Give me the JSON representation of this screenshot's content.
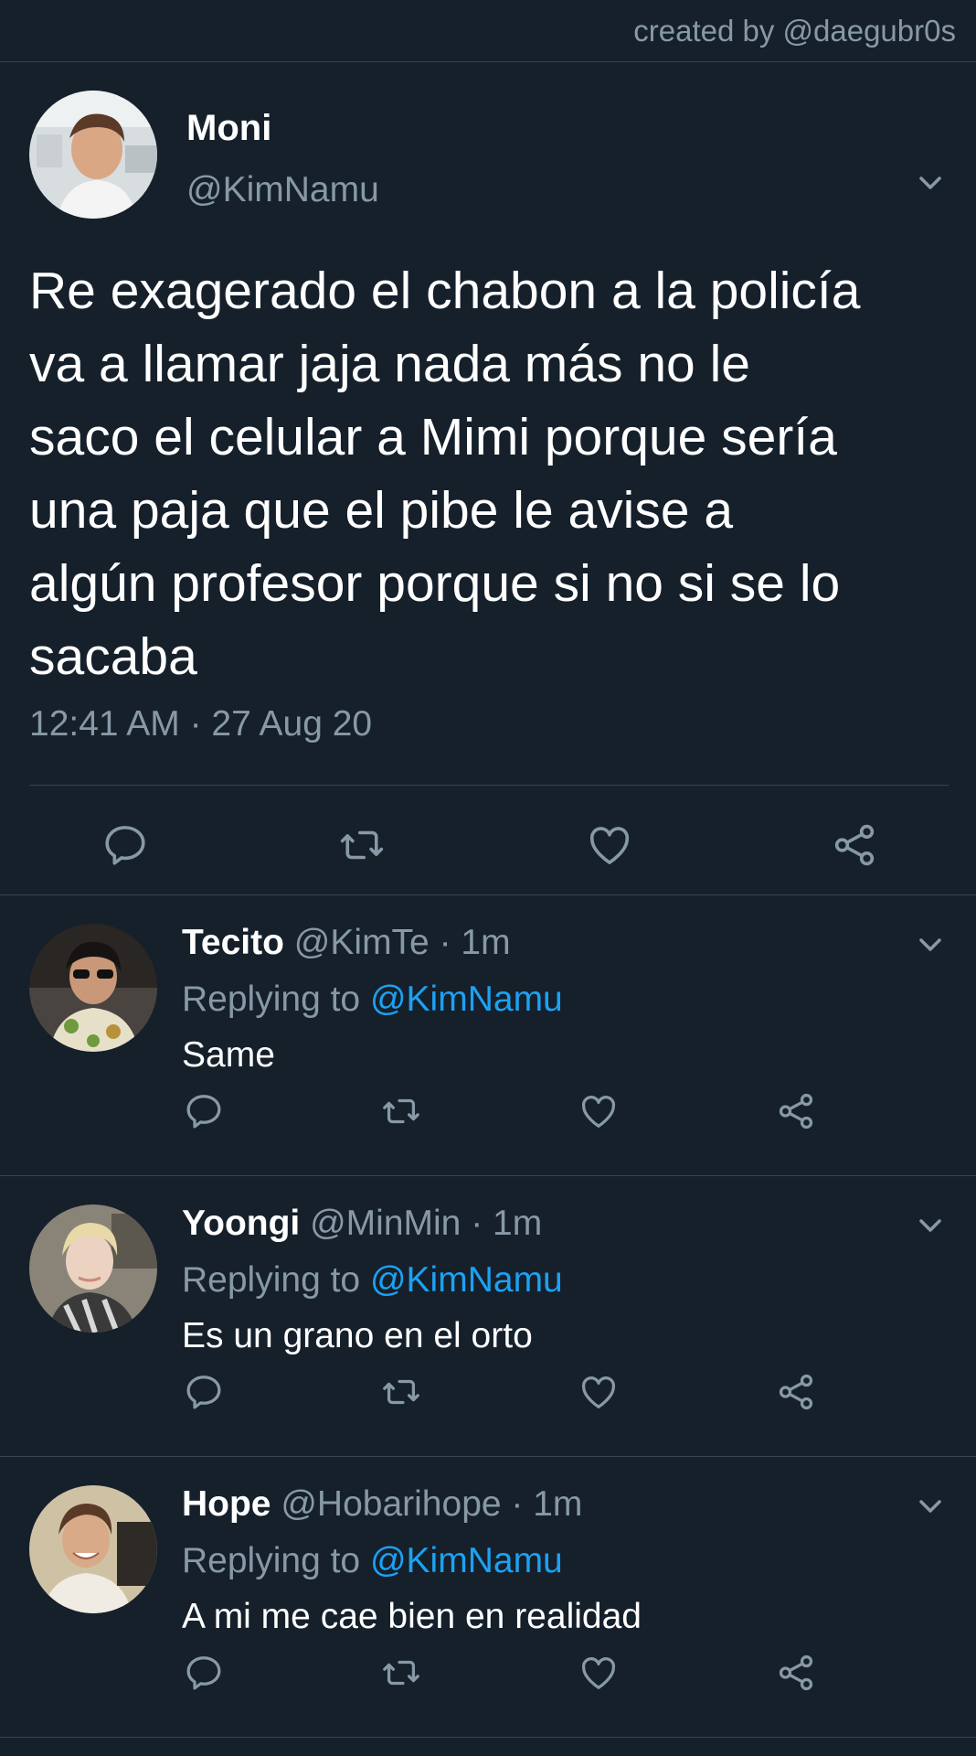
{
  "header": {
    "credit": "created by @daegubr0s"
  },
  "main_tweet": {
    "name": "Moni",
    "handle": "@KimNamu",
    "text": "Re exagerado el chabon a la policía\nva a llamar jaja nada más no le\nsaco el celular a Mimi porque sería\nuna paja que el pibe le avise a\nalgún profesor porque si no si se lo\nsacaba",
    "timestamp": "12:41 AM · 27 Aug 20",
    "actions": [
      "reply-icon",
      "retweet-icon",
      "like-icon",
      "share-icon"
    ]
  },
  "replies": [
    {
      "name": "Tecito",
      "meta": " @KimTe · 1m",
      "replying_prefix": "Replying to ",
      "replying_handle": "@KimNamu",
      "text": "Same"
    },
    {
      "name": "Yoongi",
      "meta": " @MinMin · 1m",
      "replying_prefix": "Replying to ",
      "replying_handle": "@KimNamu",
      "text": "Es un grano en el orto"
    },
    {
      "name": "Hope",
      "meta": " @Hobarihope · 1m",
      "replying_prefix": "Replying to ",
      "replying_handle": "@KimNamu",
      "text": "A mi me cae bien en realidad"
    }
  ],
  "colors": {
    "background": "#15202b",
    "divider": "#38444d",
    "secondary_text": "#8899a6",
    "link": "#1da1f2",
    "icon": "#8899a6"
  }
}
